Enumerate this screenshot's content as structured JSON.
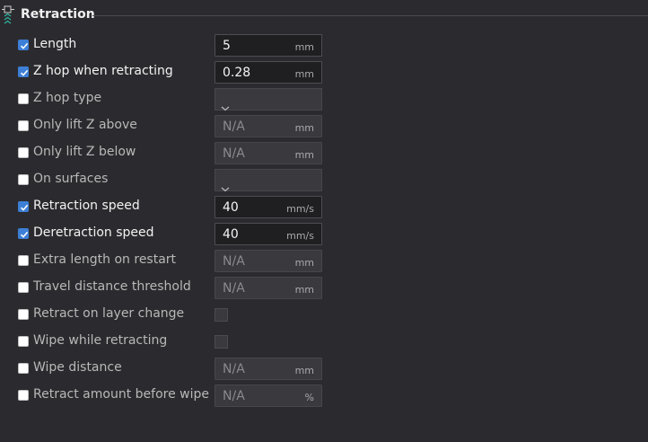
{
  "section": {
    "title": "Retraction",
    "icon": "retraction-icon"
  },
  "colors": {
    "accent": "#3d7fd6",
    "background": "#2b2b2f"
  },
  "rows": [
    {
      "key": "length",
      "label": "Length",
      "checked": true,
      "control": "text",
      "value": "5",
      "unit": "mm"
    },
    {
      "key": "z-hop-when-retracting",
      "label": "Z hop when retracting",
      "checked": true,
      "control": "text",
      "value": "0.28",
      "unit": "mm"
    },
    {
      "key": "z-hop-type",
      "label": "Z hop type",
      "checked": false,
      "control": "dropdown",
      "value": "",
      "unit": ""
    },
    {
      "key": "only-lift-z-above",
      "label": "Only lift Z above",
      "checked": false,
      "control": "text",
      "value": "N/A",
      "unit": "mm"
    },
    {
      "key": "only-lift-z-below",
      "label": "Only lift Z below",
      "checked": false,
      "control": "text",
      "value": "N/A",
      "unit": "mm"
    },
    {
      "key": "on-surfaces",
      "label": "On surfaces",
      "checked": false,
      "control": "dropdown",
      "value": "",
      "unit": ""
    },
    {
      "key": "retraction-speed",
      "label": "Retraction speed",
      "checked": true,
      "control": "text",
      "value": "40",
      "unit": "mm/s"
    },
    {
      "key": "deretraction-speed",
      "label": "Deretraction speed",
      "checked": true,
      "control": "text",
      "value": "40",
      "unit": "mm/s"
    },
    {
      "key": "extra-length-on-restart",
      "label": "Extra length on restart",
      "checked": false,
      "control": "text",
      "value": "N/A",
      "unit": "mm"
    },
    {
      "key": "travel-distance-threshold",
      "label": "Travel distance threshold",
      "checked": false,
      "control": "text",
      "value": "N/A",
      "unit": "mm"
    },
    {
      "key": "retract-on-layer-change",
      "label": "Retract on layer change",
      "checked": false,
      "control": "checkbox",
      "value": "",
      "unit": ""
    },
    {
      "key": "wipe-while-retracting",
      "label": "Wipe while retracting",
      "checked": false,
      "control": "checkbox",
      "value": "",
      "unit": ""
    },
    {
      "key": "wipe-distance",
      "label": "Wipe distance",
      "checked": false,
      "control": "text",
      "value": "N/A",
      "unit": "mm"
    },
    {
      "key": "retract-amount-before-wipe",
      "label": "Retract amount before wipe",
      "checked": false,
      "control": "text",
      "value": "N/A",
      "unit": "%"
    }
  ]
}
